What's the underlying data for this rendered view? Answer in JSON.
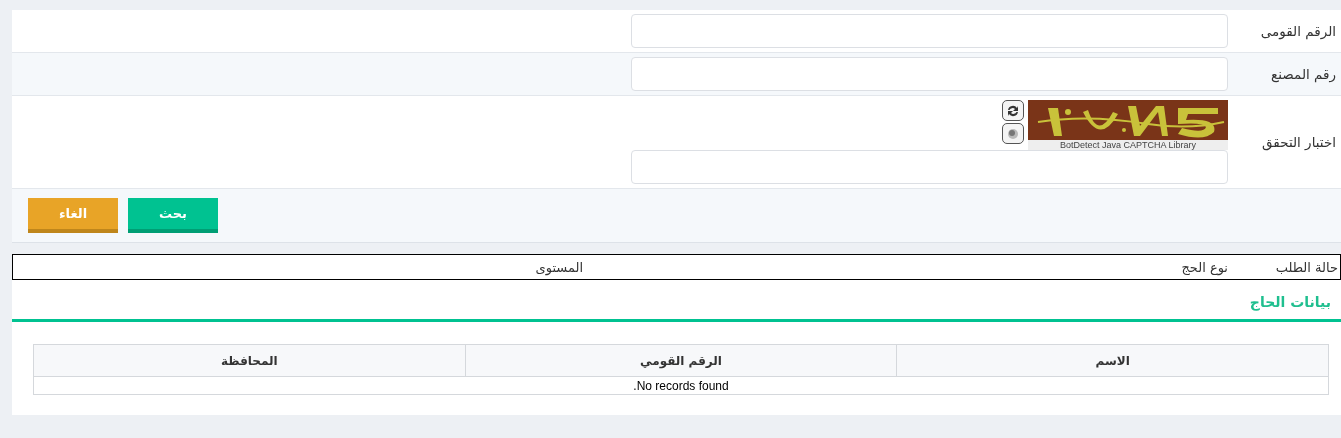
{
  "form": {
    "fields": [
      {
        "label": "الرقم القومى",
        "kind": "text"
      },
      {
        "label": "رقم المصنع",
        "kind": "text"
      },
      {
        "label": "اختبار التحقق",
        "kind": "captcha",
        "caption": "BotDetect Java CAPTCHA Library"
      }
    ],
    "buttons": [
      {
        "label": "بحث",
        "kind": "primary"
      },
      {
        "label": "الغاء",
        "kind": "cancel"
      }
    ]
  },
  "summary": [
    "حالة الطلب",
    "نوع الحج",
    "المستوى"
  ],
  "section": {
    "title": "بيانات الحاج",
    "table": {
      "columns": [
        "الاسم",
        "الرقم القومي",
        "المحافظة"
      ],
      "empty_message": ".No records found"
    }
  }
}
